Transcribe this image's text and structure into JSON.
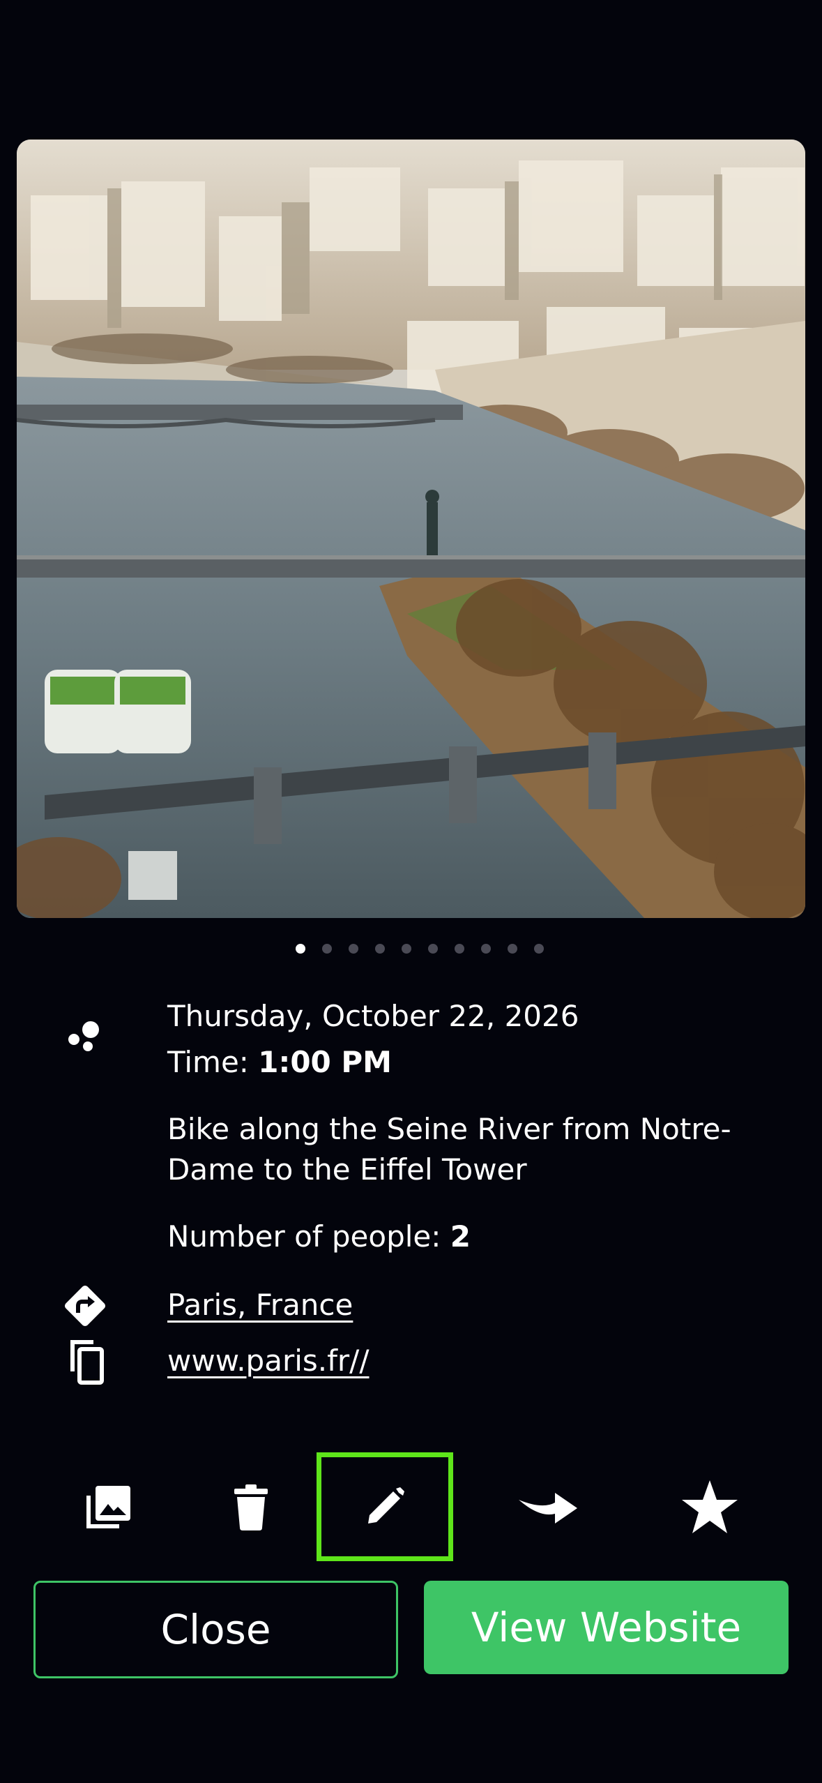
{
  "photo": {
    "subject": "Seine River with bridges and Statue of Liberty replica, Paris"
  },
  "pager": {
    "total": 10,
    "active_index": 0
  },
  "event": {
    "date": "Thursday, October 22, 2026",
    "time_label": "Time: ",
    "time_value": "1:00 PM",
    "description": "Bike along the Seine River from Notre-Dame to the Eiffel Tower",
    "people_label": "Number of people: ",
    "people_value": "2",
    "location": "Paris, France",
    "website": "www.paris.fr//"
  },
  "toolbar": {
    "items": [
      "gallery-icon",
      "trash-icon",
      "pencil-icon",
      "share-icon",
      "star-icon"
    ],
    "selected": "pencil-icon"
  },
  "buttons": {
    "close_label": "Close",
    "view_label": "View Website"
  },
  "colors": {
    "background": "#03040c",
    "accent_green": "#3ec566",
    "selection_green": "#5ee51a"
  }
}
